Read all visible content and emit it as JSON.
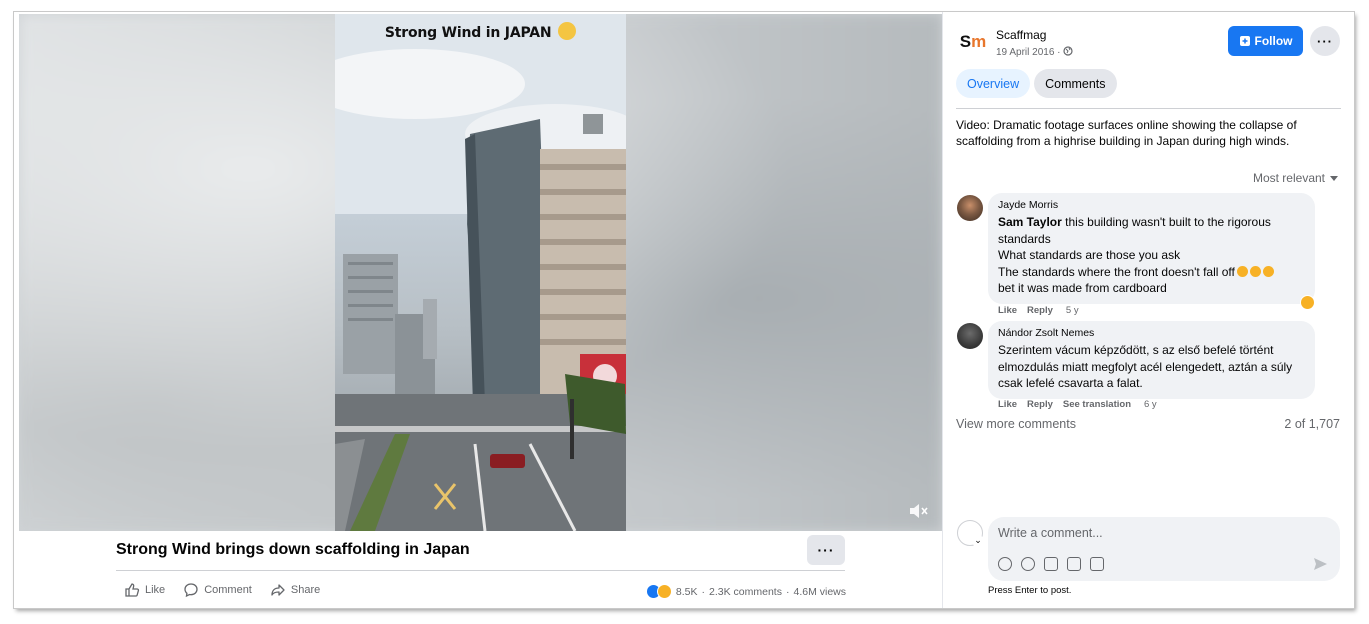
{
  "video": {
    "overlay_title": "Strong Wind in JAPAN",
    "title": "Strong Wind brings down scaffolding in Japan",
    "more_label": "···",
    "actions": {
      "like": "Like",
      "comment": "Comment",
      "share": "Share"
    },
    "stats": {
      "reactions": "8.5K",
      "comments": "2.3K comments",
      "separator": "·",
      "views": "4.6M views"
    }
  },
  "post": {
    "page_name": "Scaffmag",
    "logo_s": "S",
    "logo_m": "m",
    "date": "19 April 2016 ·",
    "follow_label": "Follow",
    "more_label": "···",
    "tabs": {
      "overview": "Overview",
      "comments": "Comments"
    },
    "description": "Video: Dramatic footage surfaces online showing the collapse of scaffolding from a highrise building in Japan during high winds."
  },
  "comments": {
    "sort_label": "Most relevant",
    "items": [
      {
        "author": "Jayde Morris",
        "mention": "Sam Taylor",
        "line1": " this building wasn't built to the rigorous standards",
        "line2": "What standards are those you ask",
        "line3": "The standards where the front doesn't fall off",
        "line4": "bet it was made from cardboard",
        "like": "Like",
        "reply": "Reply",
        "time": "5 y"
      },
      {
        "author": "Nándor Zsolt Nemes",
        "text": "Szerintem vácum képződött, s az első befelé történt elmozdulás miatt megfolyt acél elengedett, aztán a súly csak lefelé csavarta a falat.",
        "like": "Like",
        "reply": "Reply",
        "translate": "See translation",
        "time": "6 y"
      }
    ],
    "view_more": "View more comments",
    "count": "2 of 1,707"
  },
  "composer": {
    "placeholder": "Write a comment...",
    "hint": "Press Enter to post.",
    "tools": [
      "avatar-sticker-icon",
      "emoji-icon",
      "camera-icon",
      "gif-icon",
      "sticker-icon"
    ]
  },
  "colors": {
    "accent": "#1877f2",
    "meta_gray": "#65676b",
    "bubble": "#f0f2f5",
    "logo_orange": "#e8762c"
  }
}
